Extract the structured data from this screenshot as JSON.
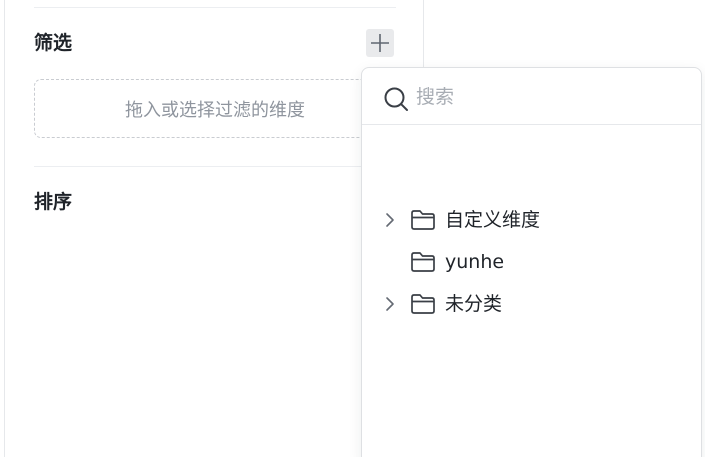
{
  "filter_section": {
    "title": "筛选",
    "add_button_icon": "plus-icon",
    "drop_zone_text": "拖入或选择过滤的维度"
  },
  "sort_section": {
    "title": "排序"
  },
  "dimension_picker": {
    "search": {
      "placeholder": "搜索",
      "value": "",
      "icon": "search-icon"
    },
    "items": [
      {
        "label": "自定义维度",
        "expandable": true,
        "icon": "folder-icon"
      },
      {
        "label": "yunhe",
        "expandable": false,
        "icon": "folder-icon"
      },
      {
        "label": "未分类",
        "expandable": true,
        "icon": "folder-icon"
      }
    ]
  },
  "colors": {
    "text_primary": "#1f2329",
    "text_placeholder": "#8f959e",
    "border": "#dee0e3",
    "button_bg": "#e9eaec"
  }
}
